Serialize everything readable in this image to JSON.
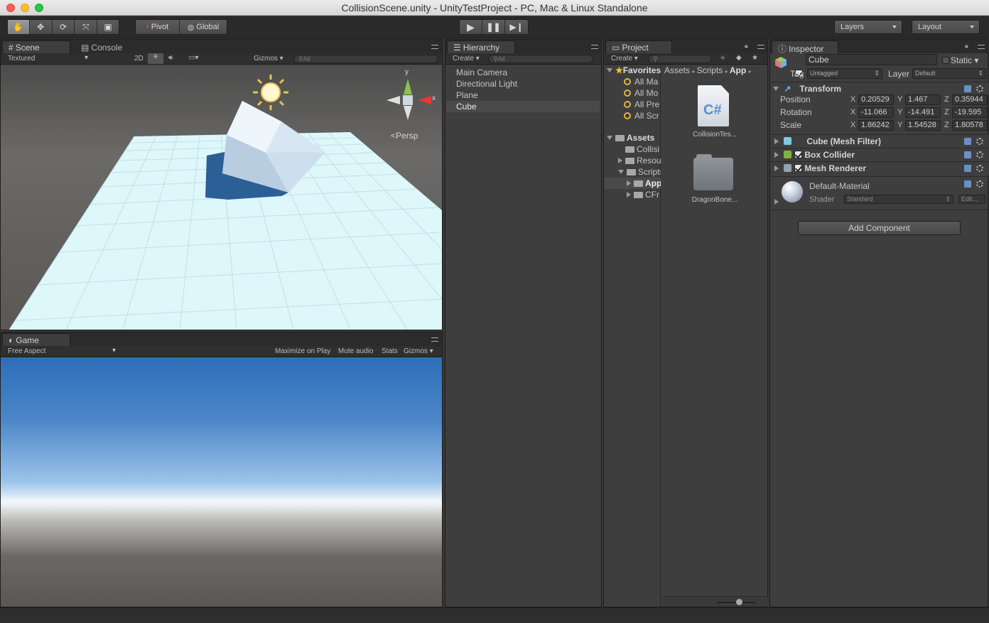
{
  "window": {
    "title": "CollisionScene.unity - UnityTestProject - PC, Mac & Linux Standalone"
  },
  "toolbar": {
    "pivot_label": "Pivot",
    "global_label": "Global",
    "layers_label": "Layers",
    "layout_label": "Layout"
  },
  "scene": {
    "tab_label": "Scene",
    "console_tab_label": "Console",
    "render_mode": "Textured",
    "two_d_label": "2D",
    "gizmos_label": "Gizmos",
    "search_placeholder": "All",
    "persp_label": "Persp",
    "axis_x": "x",
    "axis_y": "y"
  },
  "game": {
    "tab_label": "Game",
    "aspect": "Free Aspect",
    "maximize_label": "Maximize on Play",
    "mute_label": "Mute audio",
    "stats_label": "Stats",
    "gizmos_label": "Gizmos"
  },
  "hierarchy": {
    "tab_label": "Hierarchy",
    "create_label": "Create",
    "search_placeholder": "All",
    "items": [
      "Main Camera",
      "Directional Light",
      "Plane",
      "Cube"
    ],
    "selected_index": 3
  },
  "project": {
    "tab_label": "Project",
    "create_label": "Create",
    "favorites_label": "Favorites",
    "favorites": [
      "All Ma",
      "All Mo",
      "All Pre",
      "All Scr"
    ],
    "assets_label": "Assets",
    "folders": [
      "Collisi",
      "Resou",
      "Scripts",
      "App",
      "CFr"
    ],
    "breadcrumb": [
      "Assets",
      "Scripts",
      "App"
    ],
    "files": [
      {
        "name": "CollisionTes...",
        "icon": "csharp-file-icon",
        "badge": "C#"
      },
      {
        "name": "DragonBone...",
        "icon": "folder-icon"
      }
    ]
  },
  "inspector": {
    "tab_label": "Inspector",
    "object_name": "Cube",
    "static_label": "Static",
    "tag_label": "Tag",
    "tag_value": "Untagged",
    "layer_label": "Layer",
    "layer_value": "Default",
    "transform": {
      "title": "Transform",
      "position_label": "Position",
      "rotation_label": "Rotation",
      "scale_label": "Scale",
      "axis_x": "X",
      "axis_y": "Y",
      "axis_z": "Z",
      "position": [
        "0.20529",
        "1.467",
        "0.35944"
      ],
      "rotation": [
        "-11.066",
        "-14.491",
        "-19.595"
      ],
      "scale": [
        "1.86242",
        "1.54528",
        "1.80578"
      ]
    },
    "components": [
      "Cube (Mesh Filter)",
      "Box Collider",
      "Mesh Renderer"
    ],
    "material": {
      "name": "Default-Material",
      "shader_label": "Shader",
      "shader_value": "Standard",
      "edit_label": "Edit..."
    },
    "add_component_label": "Add Component"
  },
  "colors": {
    "selection": "#4a4a4a",
    "sky_top": "#2f6db8",
    "horizon": "#f4f7fb",
    "ground": "#5a5754",
    "plane": "#ddf7fb",
    "cube": "#c9dbe9"
  }
}
